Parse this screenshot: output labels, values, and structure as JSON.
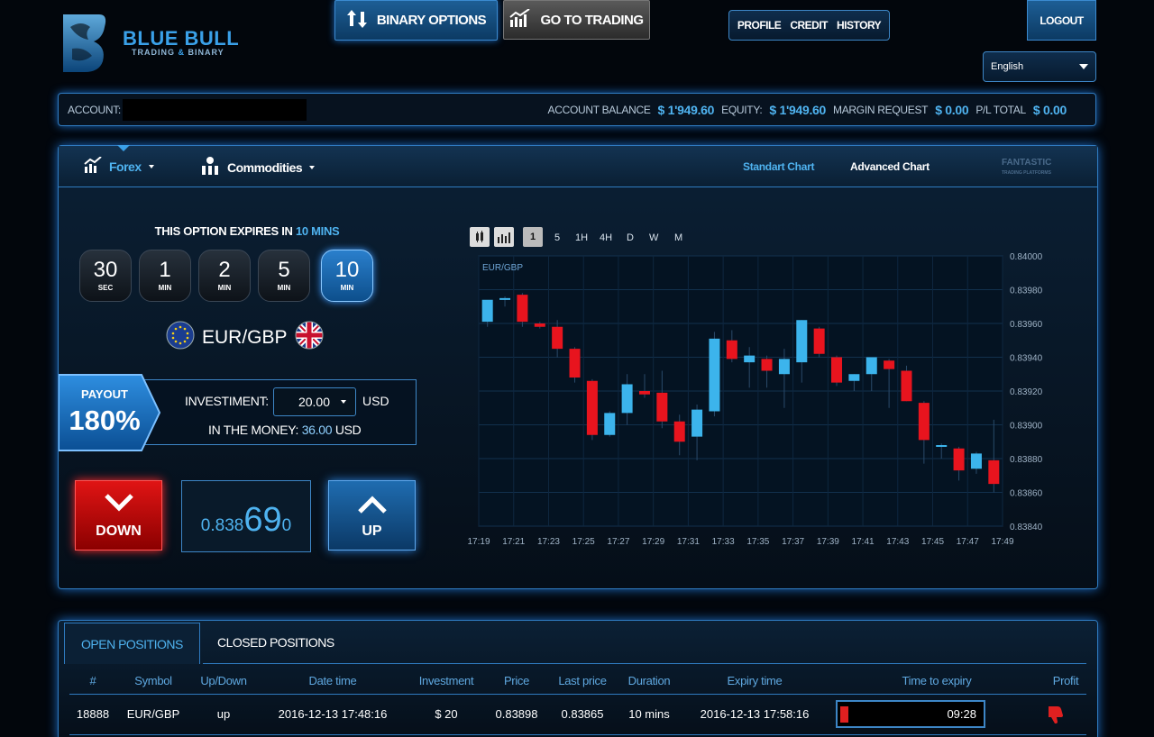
{
  "brand": {
    "name": "BLUE BULL",
    "tagline_a": "TRADING ",
    "tagline_amp": "& ",
    "tagline_b": "BINARY"
  },
  "topnav": {
    "binary_options": "BINARY OPTIONS",
    "go_to_trading": "GO TO TRADING",
    "profile": "PROFILE",
    "credit": "CREDIT",
    "history": "HISTORY",
    "logout": "LOGOUT"
  },
  "language": {
    "selected": "English"
  },
  "account": {
    "label": "ACCOUNT:",
    "balance_label": "ACCOUNT BALANCE",
    "balance": "$ 1'949.60",
    "equity_label": "EQUITY:",
    "equity": "$ 1'949.60",
    "margin_label": "MARGIN REQUEST",
    "margin": "$ 0.00",
    "pl_label": "P/L TOTAL",
    "pl": "$ 0.00"
  },
  "markets": {
    "forex": "Forex",
    "commodities": "Commodities",
    "standard_chart": "Standart Chart",
    "advanced_chart": "Advanced Chart",
    "fantastic": "FANTASTIC",
    "fantastic_sub": "TRADING PLATFORMS"
  },
  "expiry": {
    "prefix": "THIS OPTION EXPIRES IN",
    "value": "10 MINS"
  },
  "durations": [
    {
      "num": "30",
      "unit": "SEC"
    },
    {
      "num": "1",
      "unit": "MIN"
    },
    {
      "num": "2",
      "unit": "MIN"
    },
    {
      "num": "5",
      "unit": "MIN"
    },
    {
      "num": "10",
      "unit": "MIN"
    }
  ],
  "pair": "EUR/GBP",
  "payout": {
    "label": "PAYOUT",
    "value": "180%"
  },
  "investment": {
    "label": "INVESTIMENT:",
    "value": "20.00",
    "currency": "USD",
    "itm_label": "IN THE MONEY:",
    "itm_value": "36.00",
    "itm_currency": "USD"
  },
  "trade": {
    "down": "DOWN",
    "up": "UP",
    "price_a": "0.838",
    "price_b": "69",
    "price_c": "0"
  },
  "timeframes": [
    "1",
    "5",
    "1H",
    "4H",
    "D",
    "W",
    "M"
  ],
  "chart_data": {
    "type": "candlestick",
    "series_label": "EUR/GBP",
    "ylim": [
      0.8384,
      0.84
    ],
    "y_ticks": [
      "0.84000",
      "0.83980",
      "0.83960",
      "0.83940",
      "0.83920",
      "0.83900",
      "0.83880",
      "0.83860",
      "0.83840"
    ],
    "x_ticks": [
      "17:19",
      "17:21",
      "17:23",
      "17:25",
      "17:27",
      "17:29",
      "17:31",
      "17:33",
      "17:35",
      "17:37",
      "17:39",
      "17:41",
      "17:43",
      "17:45",
      "17:47",
      "17:49"
    ],
    "up_color": "#3cb4ec",
    "down_color": "#e8141e",
    "candles": [
      {
        "t": "17:19",
        "o": 0.83961,
        "h": 0.83971,
        "l": 0.83958,
        "c": 0.83974
      },
      {
        "t": "17:20",
        "o": 0.83974,
        "h": 0.83976,
        "l": 0.8397,
        "c": 0.83975
      },
      {
        "t": "17:21",
        "o": 0.83977,
        "h": 0.83978,
        "l": 0.83958,
        "c": 0.83961
      },
      {
        "t": "17:22",
        "o": 0.8396,
        "h": 0.83961,
        "l": 0.83957,
        "c": 0.83958
      },
      {
        "t": "17:23",
        "o": 0.83958,
        "h": 0.83962,
        "l": 0.8394,
        "c": 0.83945
      },
      {
        "t": "17:24",
        "o": 0.83945,
        "h": 0.83946,
        "l": 0.83925,
        "c": 0.83928
      },
      {
        "t": "17:25",
        "o": 0.83926,
        "h": 0.83927,
        "l": 0.83891,
        "c": 0.83894
      },
      {
        "t": "17:26",
        "o": 0.83894,
        "h": 0.83908,
        "l": 0.83893,
        "c": 0.83907
      },
      {
        "t": "17:27",
        "o": 0.83907,
        "h": 0.8393,
        "l": 0.839,
        "c": 0.83924
      },
      {
        "t": "17:28",
        "o": 0.8392,
        "h": 0.8393,
        "l": 0.83916,
        "c": 0.83918
      },
      {
        "t": "17:29",
        "o": 0.83919,
        "h": 0.83932,
        "l": 0.83898,
        "c": 0.83902
      },
      {
        "t": "17:30",
        "o": 0.83902,
        "h": 0.83906,
        "l": 0.83882,
        "c": 0.8389
      },
      {
        "t": "17:31",
        "o": 0.83893,
        "h": 0.83912,
        "l": 0.83879,
        "c": 0.83909
      },
      {
        "t": "17:32",
        "o": 0.83908,
        "h": 0.83955,
        "l": 0.83905,
        "c": 0.83951
      },
      {
        "t": "17:33",
        "o": 0.8395,
        "h": 0.83956,
        "l": 0.83937,
        "c": 0.83939
      },
      {
        "t": "17:34",
        "o": 0.83937,
        "h": 0.83946,
        "l": 0.83922,
        "c": 0.83941
      },
      {
        "t": "17:35",
        "o": 0.83939,
        "h": 0.83941,
        "l": 0.83922,
        "c": 0.83932
      },
      {
        "t": "17:36",
        "o": 0.8393,
        "h": 0.83945,
        "l": 0.8391,
        "c": 0.83939
      },
      {
        "t": "17:37",
        "o": 0.83937,
        "h": 0.83962,
        "l": 0.83925,
        "c": 0.83962
      },
      {
        "t": "17:38",
        "o": 0.83957,
        "h": 0.83958,
        "l": 0.8394,
        "c": 0.83942
      },
      {
        "t": "17:39",
        "o": 0.8394,
        "h": 0.83941,
        "l": 0.83923,
        "c": 0.83925
      },
      {
        "t": "17:40",
        "o": 0.83926,
        "h": 0.8393,
        "l": 0.8392,
        "c": 0.8393
      },
      {
        "t": "17:41",
        "o": 0.8393,
        "h": 0.8394,
        "l": 0.8392,
        "c": 0.8394
      },
      {
        "t": "17:42",
        "o": 0.83938,
        "h": 0.83939,
        "l": 0.8391,
        "c": 0.83933
      },
      {
        "t": "17:43",
        "o": 0.83932,
        "h": 0.83935,
        "l": 0.83914,
        "c": 0.83914
      },
      {
        "t": "17:44",
        "o": 0.83913,
        "h": 0.83914,
        "l": 0.83877,
        "c": 0.83891
      },
      {
        "t": "17:45",
        "o": 0.83888,
        "h": 0.83889,
        "l": 0.8388,
        "c": 0.83888
      },
      {
        "t": "17:46",
        "o": 0.83886,
        "h": 0.83887,
        "l": 0.83867,
        "c": 0.83873
      },
      {
        "t": "17:47",
        "o": 0.83874,
        "h": 0.83884,
        "l": 0.83871,
        "c": 0.83883
      },
      {
        "t": "17:48",
        "o": 0.83879,
        "h": 0.83903,
        "l": 0.8386,
        "c": 0.83865
      }
    ]
  },
  "positions": {
    "tab_open": "OPEN POSITIONS",
    "tab_closed": "CLOSED POSITIONS",
    "headers": [
      "#",
      "Symbol",
      "Up/Down",
      "Date time",
      "Investment",
      "Price",
      "Last price",
      "Duration",
      "Expiry time",
      "Time to expiry",
      "Profit"
    ],
    "rows": [
      {
        "id": "18888",
        "symbol": "EUR/GBP",
        "direction": "up",
        "datetime": "2016-12-13 17:48:16",
        "investment": "$ 20",
        "price": "0.83898",
        "last_price": "0.83865",
        "duration": "10 mins",
        "expiry": "2016-12-13 17:58:16",
        "time_to_expiry": "09:28",
        "time_to_expiry_fraction": 0.05
      }
    ]
  },
  "colors": {
    "accent": "#3aa0e8",
    "down": "#e01414",
    "up": "#1f6cb0",
    "loss_icon": "#e02020"
  }
}
